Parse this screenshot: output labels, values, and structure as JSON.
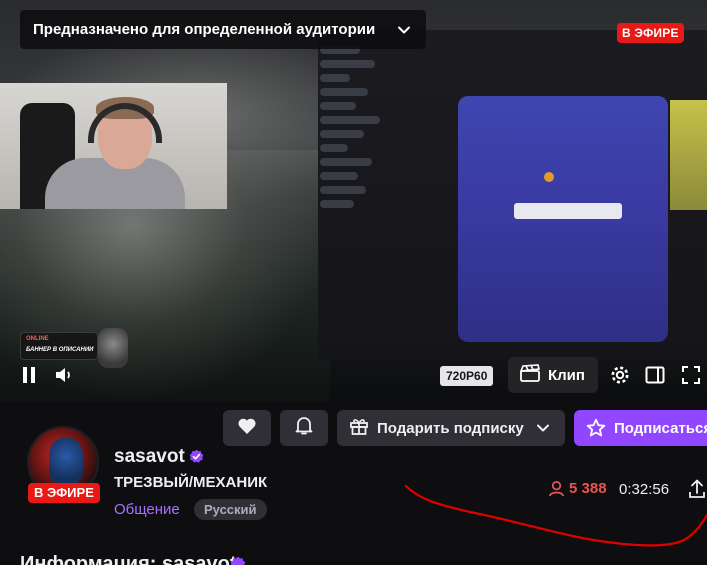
{
  "video": {
    "title_overlay": "Предназначено для определенной аудитории",
    "live_badge": "В ЭФИРЕ",
    "quality": "720P60",
    "clip_label": "Клип",
    "promo": {
      "tag": "ONLINE",
      "text": "БАННЕР В ОПИСАНИИ"
    }
  },
  "actions": {
    "gift_label": "Подарить подписку",
    "subscribe_label": "Подписаться"
  },
  "channel": {
    "name": "sasavot",
    "live_badge": "В ЭФИРЕ",
    "stream_title": "ТРЕЗВЫЙ/МЕХАНИК",
    "category": "Общение",
    "language_tag": "Русский",
    "viewers": "5 388",
    "uptime": "0:32:56"
  },
  "about": {
    "heading": "Информация: sasavot"
  },
  "colors": {
    "accent": "#9147ff",
    "live": "#e91916",
    "viewers": "#eb5353",
    "annotation": "#e00000"
  },
  "icons": [
    "chevron-down-icon",
    "pause-icon",
    "volume-icon",
    "clip-icon",
    "settings-icon",
    "theatre-mode-icon",
    "fullscreen-icon",
    "heart-icon",
    "bell-icon",
    "gift-icon",
    "star-icon",
    "verified-icon",
    "viewers-icon",
    "share-icon"
  ]
}
